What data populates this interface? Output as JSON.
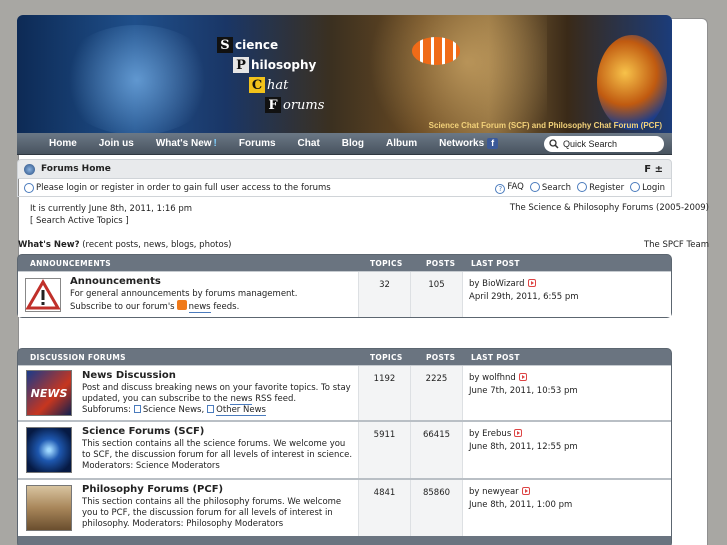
{
  "banner": {
    "title_lines": [
      {
        "letter": "S",
        "word": "cience",
        "bg": "#111111",
        "fg": "#ffffff"
      },
      {
        "letter": "P",
        "word": "hilosophy",
        "bg": "#e6e6e6",
        "fg": "#111111"
      },
      {
        "letter": "C",
        "word": "hat",
        "bg": "#f2c21a",
        "fg": "#111111"
      },
      {
        "letter": "F",
        "word": "orums",
        "bg": "#111111",
        "fg": "#ffffff"
      }
    ],
    "caption": "Science Chat Forum (SCF) and Philosophy Chat Forum (PCF)"
  },
  "nav": {
    "items": [
      "Home",
      "Join us",
      "What's New",
      "Forums",
      "Chat",
      "Blog",
      "Album",
      "Networks"
    ],
    "whats_new_accent": "!",
    "fb_glyph": "f",
    "search_placeholder": "Quick Search"
  },
  "crumbs": {
    "text": "Forums Home",
    "fontsize": "F ±"
  },
  "loginbar": {
    "message": "Please login or register in order to gain full user access to the forums",
    "links": [
      "FAQ",
      "Search",
      "Register",
      "Login"
    ]
  },
  "info": {
    "current": "It is currently June 8th, 2011, 1:16 pm",
    "active": "[ Search Active Topics ]",
    "right": "The Science & Philosophy Forums (2005-2009)",
    "whatsnew_label": "What's New?",
    "whatsnew_rest": " (recent posts, news, blogs, photos)",
    "team": "The SPCF Team"
  },
  "announcements": {
    "head": {
      "title": "ANNOUNCEMENTS",
      "topics": "TOPICS",
      "posts": "POSTS",
      "last": "LAST POST"
    },
    "rows": [
      {
        "title": "Announcements",
        "desc": "For general announcements by forums management.",
        "subscribe_pre": "Subscribe to our forum's",
        "subscribe_link": "news",
        "subscribe_post": "feeds.",
        "topics": "32",
        "posts": "105",
        "last_by": "by BioWizard",
        "last_date": "April 29th, 2011, 6:55 pm"
      }
    ]
  },
  "discussion": {
    "head": {
      "title": "DISCUSSION FORUMS",
      "topics": "TOPICS",
      "posts": "POSTS",
      "last": "LAST POST"
    },
    "rows": [
      {
        "title": "News Discussion",
        "desc_pre": "Post and discuss breaking news on your favorite topics. To stay updated, you can subscribe to the",
        "desc_link": "news",
        "desc_post": "RSS feed.",
        "subforums_label": "Subforums:",
        "subforums": [
          "Science News,",
          "Other News"
        ],
        "topics": "1192",
        "posts": "2225",
        "last_by": "by wolfhnd",
        "last_date": "June 7th, 2011, 10:53 pm"
      },
      {
        "title": "Science Forums (SCF)",
        "desc": "This section contains all the science forums. We welcome you to SCF, the discussion forum for all levels of interest in science. Moderators: Science Moderators",
        "topics": "5911",
        "posts": "66415",
        "last_by": "by Erebus",
        "last_date": "June 8th, 2011, 12:55 pm"
      },
      {
        "title": "Philosophy Forums (PCF)",
        "desc": "This section contains all the philosophy forums. We welcome you to PCF, the discussion forum for all levels of interest in philosophy. Moderators: Philosophy Moderators",
        "topics": "4841",
        "posts": "85860",
        "last_by": "by newyear",
        "last_date": "June 8th, 2011, 1:00 pm"
      }
    ]
  }
}
